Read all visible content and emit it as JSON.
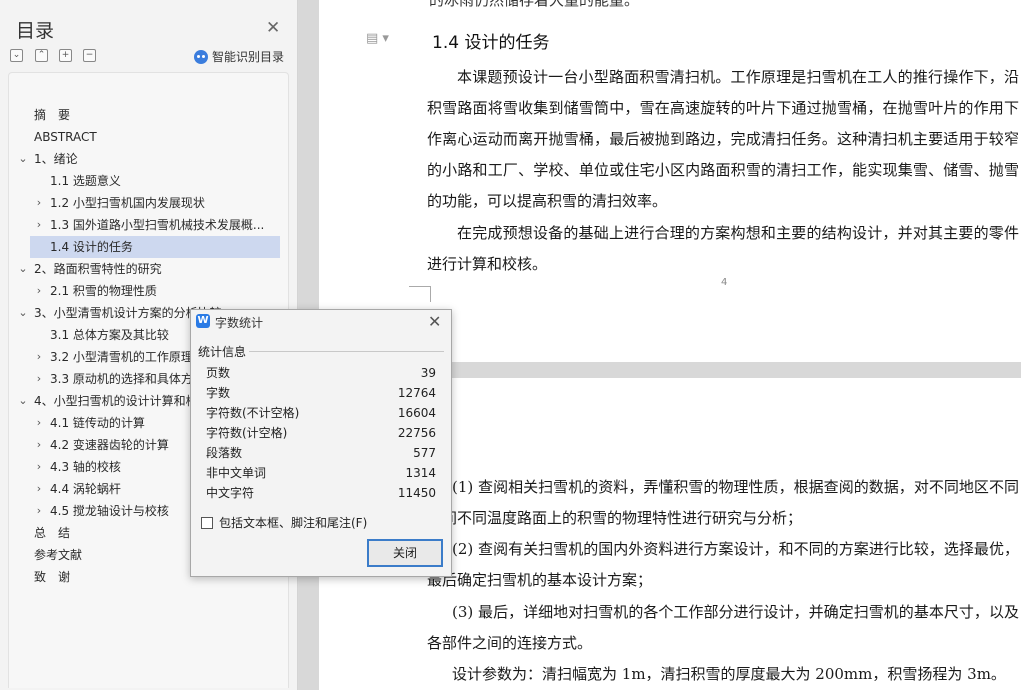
{
  "toc": {
    "title": "目录",
    "toolbar": [
      "⌄",
      "⌃",
      "+",
      "−"
    ],
    "smart_label": "智能识别目录",
    "items": [
      {
        "label": "摘　要",
        "level": 0,
        "chev": ""
      },
      {
        "label": "ABSTRACT",
        "level": 0,
        "chev": ""
      },
      {
        "label": "1、绪论",
        "level": 0,
        "chev": "⌄"
      },
      {
        "label": "1.1 选题意义",
        "level": 1,
        "chev": ""
      },
      {
        "label": "1.2 小型扫雪机国内发展现状",
        "level": 1,
        "chev": "›"
      },
      {
        "label": "1.3 国外道路小型扫雪机械技术发展概...",
        "level": 1,
        "chev": "›"
      },
      {
        "label": "1.4 设计的任务",
        "level": 1,
        "chev": "",
        "selected": true
      },
      {
        "label": "2、路面积雪特性的研究",
        "level": 0,
        "chev": "⌄"
      },
      {
        "label": "2.1 积雪的物理性质",
        "level": 1,
        "chev": "›"
      },
      {
        "label": "3、小型清雪机设计方案的分析比较",
        "level": 0,
        "chev": "⌄"
      },
      {
        "label": "3.1 总体方案及其比较",
        "level": 1,
        "chev": ""
      },
      {
        "label": "3.2 小型清雪机的工作原理",
        "level": 1,
        "chev": "›"
      },
      {
        "label": "3.3 原动机的选择和具体方",
        "level": 1,
        "chev": "›"
      },
      {
        "label": "4、小型扫雪机的设计计算和校",
        "level": 0,
        "chev": "⌄"
      },
      {
        "label": "4.1 链传动的计算",
        "level": 1,
        "chev": "›"
      },
      {
        "label": "4.2 变速器齿轮的计算",
        "level": 1,
        "chev": "›"
      },
      {
        "label": "4.3 轴的校核",
        "level": 1,
        "chev": "›"
      },
      {
        "label": "4.4 涡轮蜗杆",
        "level": 1,
        "chev": "›"
      },
      {
        "label": "4.5 搅龙轴设计与校核",
        "level": 1,
        "chev": "›"
      },
      {
        "label": "总　结",
        "level": 0,
        "chev": ""
      },
      {
        "label": "参考文献",
        "level": 0,
        "chev": ""
      },
      {
        "label": "致　谢",
        "level": 0,
        "chev": ""
      }
    ]
  },
  "doc": {
    "top_clip": "的冰雨仍然储存着大量的能量。",
    "heading": "1.4  设计的任务",
    "p1": "本课题预设计一台小型路面积雪清扫机。工作原理是扫雪机在工人的推行操作下，沿积雪路面将雪收集到储雪筒中，雪在高速旋转的叶片下通过抛雪桶，在抛雪叶片的作用下作离心运动而离开抛雪桶，最后被抛到路边，完成清扫任务。这种清扫机主要适用于较窄的小路和工厂、学校、单位或住宅小区内路面积雪的清扫工作，能实现集雪、储雪、抛雪的功能，可以提高积雪的清扫效率。",
    "p2": "在完成预想设备的基础上进行合理的方案构想和主要的结构设计，并对其主要的零件进行计算和校核。",
    "page_number": "4",
    "item1": "(1)  查阅相关扫雪机的资料，弄懂积雪的物理性质，根据查阅的数据，对不同地区不同时间不同温度路面上的积雪的物理特性进行研究与分析；",
    "item2": "(2)  查阅有关扫雪机的国内外资料进行方案设计，和不同的方案进行比较，选择最优，最后确定扫雪机的基本设计方案；",
    "item3": "(3)  最后，详细地对扫雪机的各个工作部分进行设计，并确定扫雪机的基本尺寸，以及各部件之间的连接方式。",
    "params": "设计参数为：清扫幅宽为 1m，清扫积雪的厚度最大为 200mm，积雪扬程为 3m。"
  },
  "dialog": {
    "title": "字数统计",
    "group_label": "统计信息",
    "stats": [
      {
        "key": "页数",
        "value": "39"
      },
      {
        "key": "字数",
        "value": "12764"
      },
      {
        "key": "字符数(不计空格)",
        "value": "16604"
      },
      {
        "key": "字符数(计空格)",
        "value": "22756"
      },
      {
        "key": "段落数",
        "value": "577"
      },
      {
        "key": "非中文单词",
        "value": "1314"
      },
      {
        "key": "中文字符",
        "value": "11450"
      }
    ],
    "include_label": "包括文本框、脚注和尾注(F)",
    "close_label": "关闭"
  }
}
